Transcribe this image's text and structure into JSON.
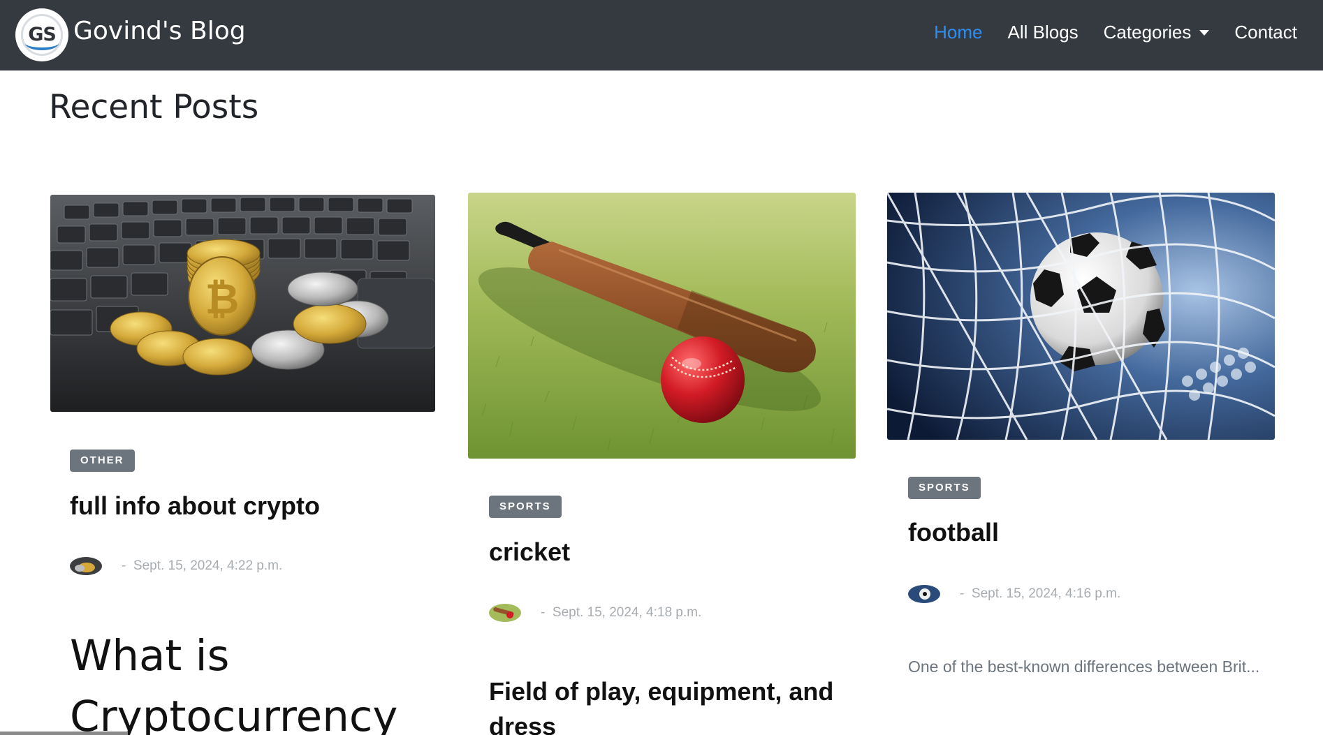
{
  "brand": {
    "name": "Govind's Blog",
    "logo_text": "GS",
    "logo_icon": "gs-logo-icon"
  },
  "nav": {
    "home": "Home",
    "all_blogs": "All Blogs",
    "categories": "Categories",
    "contact": "Contact",
    "active_color": "#2d8ff5"
  },
  "page": {
    "title": "Recent Posts"
  },
  "posts": [
    {
      "category": "OTHER",
      "title": "full info about crypto",
      "date": "Sept. 15, 2024, 4:22 p.m.",
      "date_prefix": "-",
      "image": "bitcoin-coins-on-laptop-image",
      "content_heading": "What is Cryptocurrency"
    },
    {
      "category": "SPORTS",
      "title": "cricket",
      "date": "Sept. 15, 2024, 4:18 p.m.",
      "date_prefix": "-",
      "image": "cricket-bat-and-ball-image",
      "content_heading": "Field of play, equipment, and dress"
    },
    {
      "category": "SPORTS",
      "title": "football",
      "date": "Sept. 15, 2024, 4:16 p.m.",
      "date_prefix": "-",
      "image": "football-in-net-image",
      "excerpt": "One of the best-known differences between Brit..."
    }
  ],
  "colors": {
    "navbar": "#343a40",
    "badge": "#6c757d",
    "meta": "#a7acb1"
  }
}
